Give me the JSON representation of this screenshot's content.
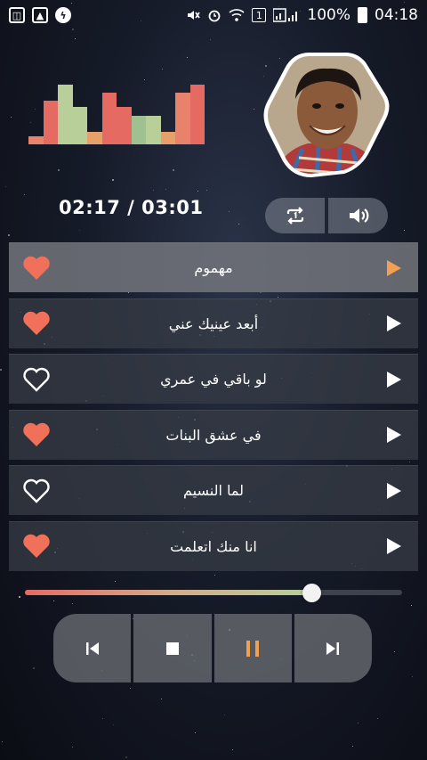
{
  "status_bar": {
    "battery": "100%",
    "time": "04:18",
    "sim_badge": "1"
  },
  "player": {
    "time_display": "02:17 / 03:01",
    "progress_fraction": 0.76,
    "equalizer_levels": [
      0.12,
      0.68,
      0.93,
      0.58,
      0.19,
      0.81,
      0.58,
      0.44,
      0.44,
      0.2,
      0.81,
      0.93
    ],
    "equalizer_colors": [
      "#e8826a",
      "#e56a62",
      "#b8cf9a",
      "#b8cf9a",
      "#e8a06a",
      "#e56a62",
      "#e56a62",
      "#9fc090",
      "#b8cf9a",
      "#e8a06a",
      "#e8826a",
      "#e56a62"
    ]
  },
  "playlist": [
    {
      "title": "مهموم",
      "favorite": true,
      "active": true
    },
    {
      "title": "أبعد عينيك عني",
      "favorite": true,
      "active": false
    },
    {
      "title": "لو باقي في عمري",
      "favorite": false,
      "active": false
    },
    {
      "title": "في عشق البنات",
      "favorite": true,
      "active": false
    },
    {
      "title": "لما النسيم",
      "favorite": false,
      "active": false
    },
    {
      "title": "انا منك اتعلمت",
      "favorite": true,
      "active": false
    }
  ],
  "colors": {
    "accent_heart": "#f0705a",
    "accent_active": "#f0a050",
    "icon_white": "#ffffff"
  },
  "icons": {
    "repeat": "repeat-one-icon",
    "volume": "volume-icon",
    "previous": "skip-previous-icon",
    "stop": "stop-icon",
    "pause": "pause-icon",
    "next": "skip-next-icon"
  }
}
